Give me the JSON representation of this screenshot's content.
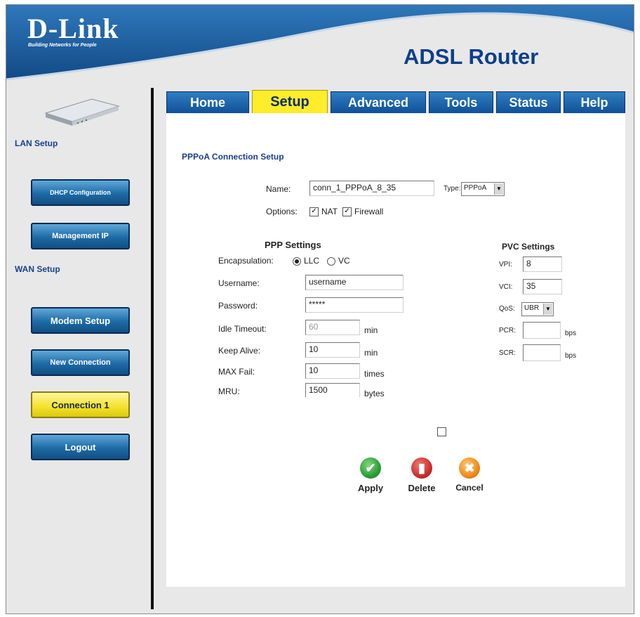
{
  "header": {
    "logo": "D-Link",
    "tagline": "Building Networks for People",
    "product": "ADSL Router"
  },
  "sidebar": {
    "lan_section": "LAN Setup",
    "wan_section": "WAN Setup",
    "buttons": {
      "dhcp": "DHCP Configuration",
      "management_ip": "Management IP",
      "modem_setup": "Modem Setup",
      "new_connection": "New Connection",
      "connection1": "Connection 1",
      "logout": "Logout"
    }
  },
  "tabs": [
    "Home",
    "Setup",
    "Advanced",
    "Tools",
    "Status",
    "Help"
  ],
  "active_tab": "Setup",
  "form": {
    "title": "PPPoA Connection Setup",
    "name_label": "Name:",
    "name_value": "conn_1_PPPoA_8_35",
    "type_label": "Type:",
    "type_value": "PPPoA",
    "options_label": "Options:",
    "nat_label": "NAT",
    "nat_checked": true,
    "firewall_label": "Firewall",
    "firewall_checked": true
  },
  "ppp": {
    "heading": "PPP Settings",
    "encapsulation_label": "Encapsulation:",
    "encap_options": [
      "LLC",
      "VC"
    ],
    "encap_selected": "LLC",
    "username_label": "Username:",
    "username_value": "username",
    "password_label": "Password:",
    "password_value": "*****",
    "idle_label": "Idle Timeout:",
    "idle_value": "60",
    "idle_unit": "min",
    "keepalive_label": "Keep Alive:",
    "keepalive_value": "10",
    "keepalive_unit": "min",
    "maxfail_label": "MAX Fail:",
    "maxfail_value": "10",
    "maxfail_unit": "times",
    "mru_label": "MRU:",
    "mru_value": "1500",
    "mru_unit": "bytes"
  },
  "pvc": {
    "heading": "PVC Settings",
    "vpi_label": "VPI:",
    "vpi_value": "8",
    "vci_label": "VCI:",
    "vci_value": "35",
    "qos_label": "QoS:",
    "qos_value": "UBR",
    "pcr_label": "PCR:",
    "pcr_value": "",
    "pcr_unit": "bps",
    "scr_label": "SCR:",
    "scr_value": "",
    "scr_unit": "bps"
  },
  "actions": {
    "apply": "Apply",
    "delete": "Delete",
    "cancel": "Cancel"
  },
  "colors": {
    "header_blue": "#1b5d9e",
    "tab_blue": "#0f4f96",
    "active_yellow": "#ffec2a",
    "apply_green": "#2e9d3a",
    "delete_red": "#c9302c",
    "cancel_orange": "#f08a1c"
  }
}
